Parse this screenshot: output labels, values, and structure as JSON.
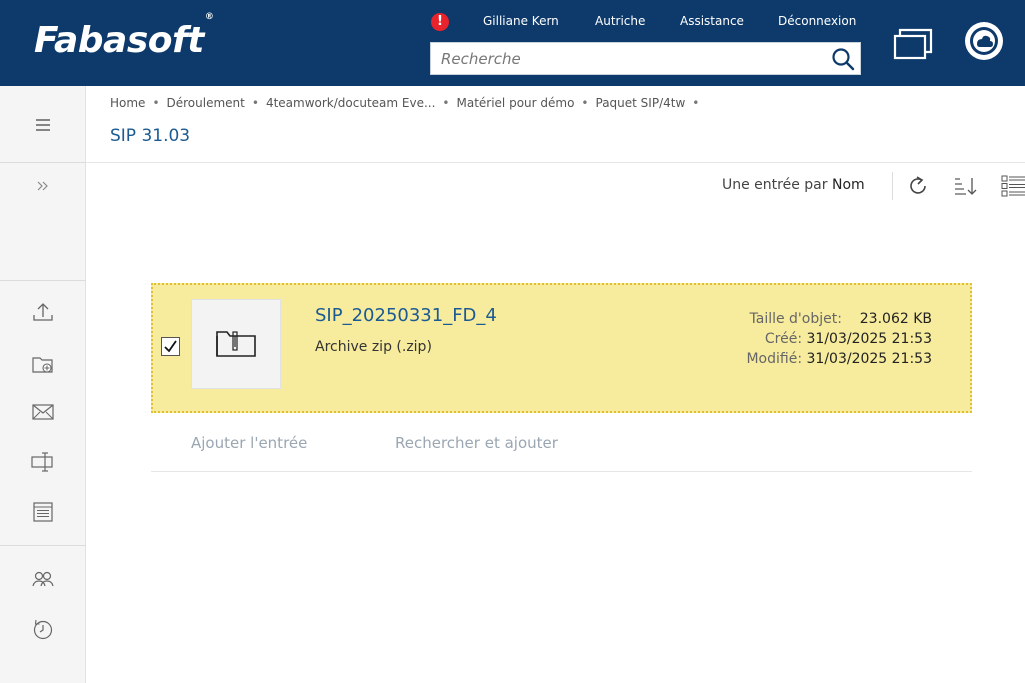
{
  "header": {
    "logo_text": "Fabasoft",
    "logo_mark": "®",
    "user_name": "Gilliane Kern",
    "region": "Autriche",
    "assistance": "Assistance",
    "logout": "Déconnexion",
    "search_placeholder": "Recherche",
    "alert_glyph": "!",
    "icons": [
      "alert-icon",
      "search-icon",
      "windows-icon",
      "cloud-user-icon"
    ]
  },
  "breadcrumb": {
    "items": [
      "Home",
      "Déroulement",
      "4teamwork/docuteam Eve...",
      "Matériel pour démo",
      "Paquet SIP/4tw",
      ""
    ],
    "separator": "•"
  },
  "page": {
    "title": "SIP 31.03"
  },
  "toolbar": {
    "view_prefix": "Une entrée par",
    "view_sort": "Nom",
    "icons": [
      "refresh-icon",
      "sort-icon",
      "view-list-icon"
    ]
  },
  "sidebar": {
    "icons": [
      "menu-icon",
      "expand-icon",
      "upload-icon",
      "new-folder-icon",
      "mail-icon",
      "rename-icon",
      "list-icon",
      "team-icon",
      "history-icon"
    ]
  },
  "item": {
    "selected": true,
    "name": "SIP_20250331_FD_4",
    "type": "Archive zip (.zip)",
    "size_label": "Taille d'objet:",
    "size_value": "23.062 KB",
    "created_label": "Créé:",
    "created_value": "31/03/2025 21:53",
    "modified_label": "Modifié:",
    "modified_value": "31/03/2025 21:53"
  },
  "actions": {
    "add_entry": "Ajouter l'entrée",
    "search_add": "Rechercher et ajouter"
  },
  "colors": {
    "header_bg": "#0d3a6b",
    "accent_blue": "#1b5a92",
    "selection_bg": "#f7ec9e",
    "selection_border": "#e0c030",
    "alert_red": "#e8232b"
  }
}
